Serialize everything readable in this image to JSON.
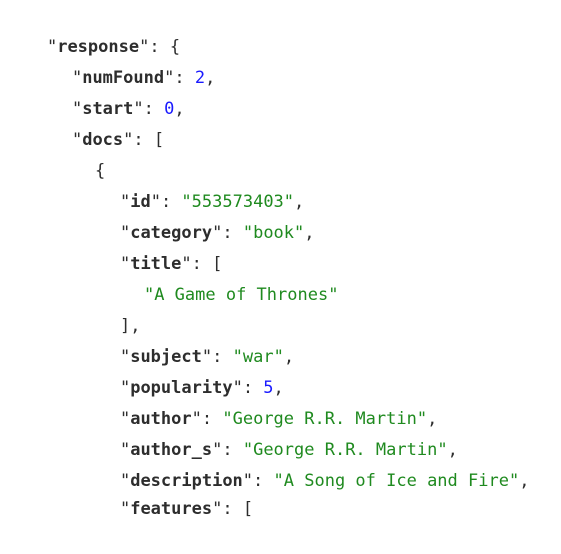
{
  "lines": [
    {
      "key": "response",
      "sep": ": ",
      "open": "{"
    },
    {
      "key": "numFound",
      "sep": ": ",
      "num": "2",
      "tail": ","
    },
    {
      "key": "start",
      "sep": ": ",
      "num": "0",
      "tail": ","
    },
    {
      "key": "docs",
      "sep": ": ",
      "open": "["
    },
    {
      "open": "{"
    },
    {
      "key": "id",
      "sep": ": ",
      "str": "553573403",
      "tail": ","
    },
    {
      "key": "category",
      "sep": ": ",
      "str": "book",
      "tail": ","
    },
    {
      "key": "title",
      "sep": ": ",
      "open": "["
    },
    {
      "str": "A Game of Thrones"
    },
    {
      "close": "],"
    },
    {
      "key": "subject",
      "sep": ": ",
      "str": "war",
      "tail": ","
    },
    {
      "key": "popularity",
      "sep": ": ",
      "num": "5",
      "tail": ","
    },
    {
      "key": "author",
      "sep": ": ",
      "str": "George R.R. Martin",
      "tail": ","
    },
    {
      "key": "author_s",
      "sep": ": ",
      "str": "George R.R. Martin",
      "tail": ","
    },
    {
      "key": "description",
      "sep": ": ",
      "str": "A Song of Ice and Fire",
      "tail": ","
    },
    {
      "key": "features",
      "sep": ": ",
      "open": "["
    }
  ]
}
